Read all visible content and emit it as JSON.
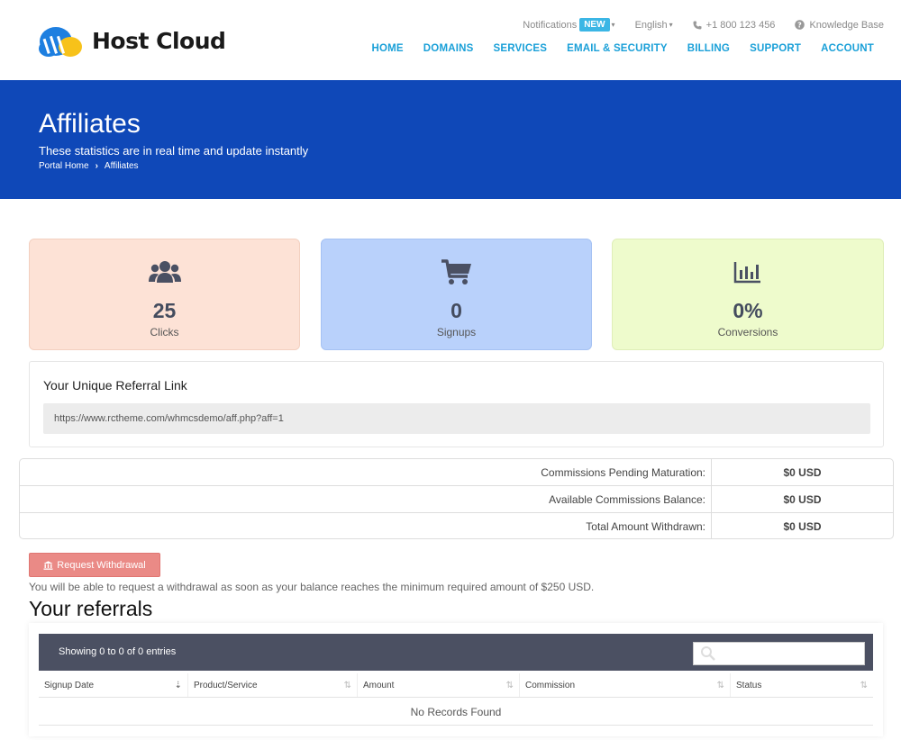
{
  "brand": {
    "name": "Host Cloud",
    "colors": {
      "primary": "#0f48b8",
      "nav": "#1aa0d8",
      "badge": "#3bb6e5",
      "withdraw": "#ea8a86"
    }
  },
  "topbar": {
    "notifications": "Notifications",
    "new_badge": "NEW",
    "language": "English",
    "phone": "+1 800 123 456",
    "knowledge_base": "Knowledge Base"
  },
  "nav": [
    "HOME",
    "DOMAINS",
    "SERVICES",
    "EMAIL & SECURITY",
    "BILLING",
    "SUPPORT",
    "ACCOUNT"
  ],
  "banner": {
    "title": "Affiliates",
    "subtitle": "These statistics are in real time and update instantly",
    "breadcrumb": [
      "Portal Home",
      "Affiliates"
    ]
  },
  "stats": [
    {
      "icon": "users-icon",
      "value": "25",
      "label": "Clicks"
    },
    {
      "icon": "cart-icon",
      "value": "0",
      "label": "Signups"
    },
    {
      "icon": "bar-chart-icon",
      "value": "0%",
      "label": "Conversions"
    }
  ],
  "referral_link": {
    "title": "Your Unique Referral Link",
    "url": "https://www.rctheme.com/whmcsdemo/aff.php?aff=1"
  },
  "commissions": [
    {
      "label": "Commissions Pending Maturation:",
      "value": "$0 USD"
    },
    {
      "label": "Available Commissions Balance:",
      "value": "$0 USD"
    },
    {
      "label": "Total Amount Withdrawn:",
      "value": "$0 USD"
    }
  ],
  "withdrawal": {
    "button_label": "Request Withdrawal",
    "note": "You will be able to request a withdrawal as soon as your balance reaches the minimum required amount of $250 USD."
  },
  "referrals": {
    "heading": "Your referrals",
    "showing": "Showing 0 to 0 of 0 entries",
    "columns": [
      "Signup Date",
      "Product/Service",
      "Amount",
      "Commission",
      "Status"
    ],
    "empty": "No Records Found"
  }
}
